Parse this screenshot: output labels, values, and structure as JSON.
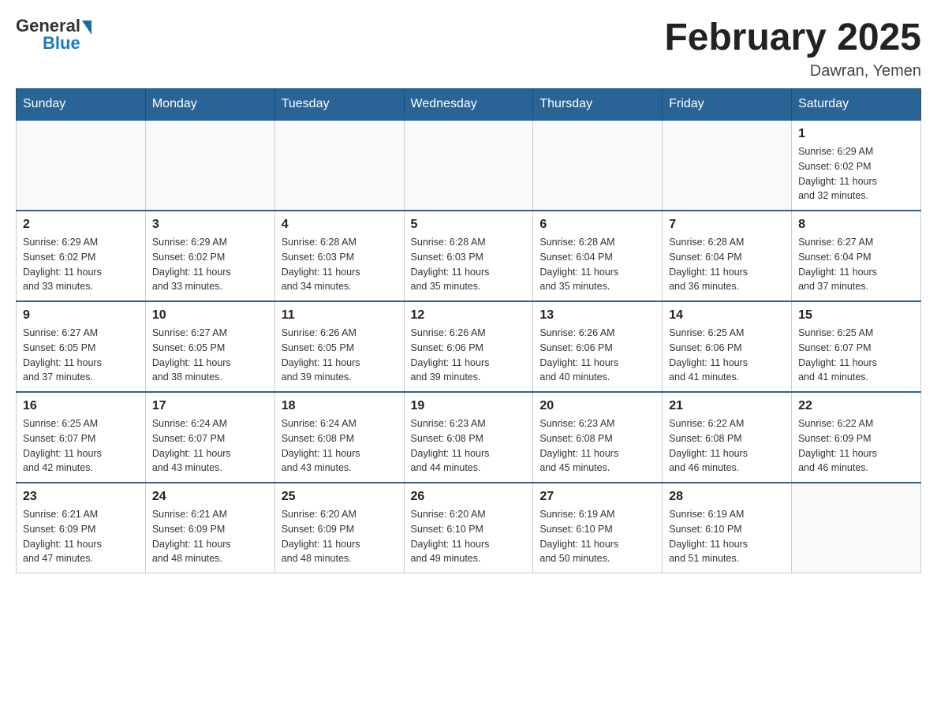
{
  "header": {
    "logo_general": "General",
    "logo_blue": "Blue",
    "month_title": "February 2025",
    "location": "Dawran, Yemen"
  },
  "days_of_week": [
    "Sunday",
    "Monday",
    "Tuesday",
    "Wednesday",
    "Thursday",
    "Friday",
    "Saturday"
  ],
  "weeks": [
    [
      {
        "day": "",
        "info": ""
      },
      {
        "day": "",
        "info": ""
      },
      {
        "day": "",
        "info": ""
      },
      {
        "day": "",
        "info": ""
      },
      {
        "day": "",
        "info": ""
      },
      {
        "day": "",
        "info": ""
      },
      {
        "day": "1",
        "info": "Sunrise: 6:29 AM\nSunset: 6:02 PM\nDaylight: 11 hours\nand 32 minutes."
      }
    ],
    [
      {
        "day": "2",
        "info": "Sunrise: 6:29 AM\nSunset: 6:02 PM\nDaylight: 11 hours\nand 33 minutes."
      },
      {
        "day": "3",
        "info": "Sunrise: 6:29 AM\nSunset: 6:02 PM\nDaylight: 11 hours\nand 33 minutes."
      },
      {
        "day": "4",
        "info": "Sunrise: 6:28 AM\nSunset: 6:03 PM\nDaylight: 11 hours\nand 34 minutes."
      },
      {
        "day": "5",
        "info": "Sunrise: 6:28 AM\nSunset: 6:03 PM\nDaylight: 11 hours\nand 35 minutes."
      },
      {
        "day": "6",
        "info": "Sunrise: 6:28 AM\nSunset: 6:04 PM\nDaylight: 11 hours\nand 35 minutes."
      },
      {
        "day": "7",
        "info": "Sunrise: 6:28 AM\nSunset: 6:04 PM\nDaylight: 11 hours\nand 36 minutes."
      },
      {
        "day": "8",
        "info": "Sunrise: 6:27 AM\nSunset: 6:04 PM\nDaylight: 11 hours\nand 37 minutes."
      }
    ],
    [
      {
        "day": "9",
        "info": "Sunrise: 6:27 AM\nSunset: 6:05 PM\nDaylight: 11 hours\nand 37 minutes."
      },
      {
        "day": "10",
        "info": "Sunrise: 6:27 AM\nSunset: 6:05 PM\nDaylight: 11 hours\nand 38 minutes."
      },
      {
        "day": "11",
        "info": "Sunrise: 6:26 AM\nSunset: 6:05 PM\nDaylight: 11 hours\nand 39 minutes."
      },
      {
        "day": "12",
        "info": "Sunrise: 6:26 AM\nSunset: 6:06 PM\nDaylight: 11 hours\nand 39 minutes."
      },
      {
        "day": "13",
        "info": "Sunrise: 6:26 AM\nSunset: 6:06 PM\nDaylight: 11 hours\nand 40 minutes."
      },
      {
        "day": "14",
        "info": "Sunrise: 6:25 AM\nSunset: 6:06 PM\nDaylight: 11 hours\nand 41 minutes."
      },
      {
        "day": "15",
        "info": "Sunrise: 6:25 AM\nSunset: 6:07 PM\nDaylight: 11 hours\nand 41 minutes."
      }
    ],
    [
      {
        "day": "16",
        "info": "Sunrise: 6:25 AM\nSunset: 6:07 PM\nDaylight: 11 hours\nand 42 minutes."
      },
      {
        "day": "17",
        "info": "Sunrise: 6:24 AM\nSunset: 6:07 PM\nDaylight: 11 hours\nand 43 minutes."
      },
      {
        "day": "18",
        "info": "Sunrise: 6:24 AM\nSunset: 6:08 PM\nDaylight: 11 hours\nand 43 minutes."
      },
      {
        "day": "19",
        "info": "Sunrise: 6:23 AM\nSunset: 6:08 PM\nDaylight: 11 hours\nand 44 minutes."
      },
      {
        "day": "20",
        "info": "Sunrise: 6:23 AM\nSunset: 6:08 PM\nDaylight: 11 hours\nand 45 minutes."
      },
      {
        "day": "21",
        "info": "Sunrise: 6:22 AM\nSunset: 6:08 PM\nDaylight: 11 hours\nand 46 minutes."
      },
      {
        "day": "22",
        "info": "Sunrise: 6:22 AM\nSunset: 6:09 PM\nDaylight: 11 hours\nand 46 minutes."
      }
    ],
    [
      {
        "day": "23",
        "info": "Sunrise: 6:21 AM\nSunset: 6:09 PM\nDaylight: 11 hours\nand 47 minutes."
      },
      {
        "day": "24",
        "info": "Sunrise: 6:21 AM\nSunset: 6:09 PM\nDaylight: 11 hours\nand 48 minutes."
      },
      {
        "day": "25",
        "info": "Sunrise: 6:20 AM\nSunset: 6:09 PM\nDaylight: 11 hours\nand 48 minutes."
      },
      {
        "day": "26",
        "info": "Sunrise: 6:20 AM\nSunset: 6:10 PM\nDaylight: 11 hours\nand 49 minutes."
      },
      {
        "day": "27",
        "info": "Sunrise: 6:19 AM\nSunset: 6:10 PM\nDaylight: 11 hours\nand 50 minutes."
      },
      {
        "day": "28",
        "info": "Sunrise: 6:19 AM\nSunset: 6:10 PM\nDaylight: 11 hours\nand 51 minutes."
      },
      {
        "day": "",
        "info": ""
      }
    ]
  ]
}
